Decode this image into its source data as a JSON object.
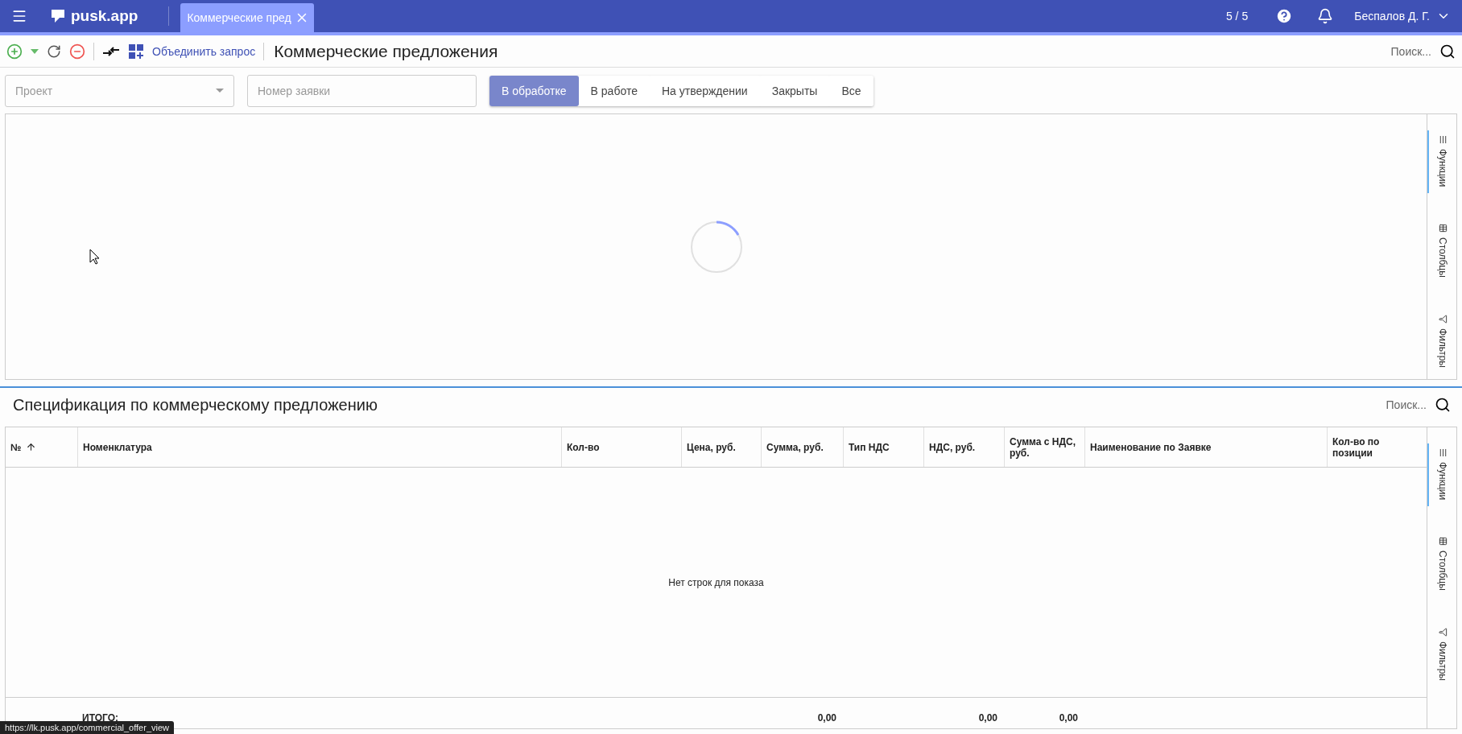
{
  "topbar": {
    "logo": "pusk.app",
    "tab": {
      "label": "Коммерческие пред",
      "selected": true
    },
    "counter": "5 / 5",
    "user": "Беспалов Д. Г."
  },
  "toolbar": {
    "merge_link": "Объединить запрос",
    "title": "Коммерческие предложения",
    "search_placeholder": "Поиск..."
  },
  "filters": {
    "project_placeholder": "Проект",
    "number_placeholder": "Номер заявки",
    "status_tabs": [
      {
        "label": "В обработке",
        "selected": true
      },
      {
        "label": "В работе",
        "selected": false
      },
      {
        "label": "На утверждении",
        "selected": false
      },
      {
        "label": "Закрыты",
        "selected": false
      },
      {
        "label": "Все",
        "selected": false
      }
    ]
  },
  "offers_grid": {
    "loading": true,
    "side_tabs": [
      {
        "kind": "functions",
        "label": "Функции",
        "selected": true
      },
      {
        "kind": "columns",
        "label": "Столбцы",
        "selected": false
      },
      {
        "kind": "filters",
        "label": "Фильтры",
        "selected": false
      }
    ]
  },
  "specification": {
    "title": "Спецификация по коммерческому предложению",
    "search_placeholder": "Поиск...",
    "columns": [
      {
        "label": "№",
        "sorted": true
      },
      {
        "label": "Номенклатура",
        "sorted": false
      },
      {
        "label": "Кол-во",
        "sorted": false
      },
      {
        "label": "Цена, руб.",
        "sorted": false
      },
      {
        "label": "Сумма, руб.",
        "sorted": false,
        "total": "0,00"
      },
      {
        "label": "Тип НДС",
        "sorted": false
      },
      {
        "label": "НДС, руб.",
        "sorted": false,
        "total": "0,00"
      },
      {
        "label": "Сумма с НДС, руб.",
        "sorted": false,
        "total": "0,00"
      },
      {
        "label": "Наименование по Заявке",
        "sorted": false
      },
      {
        "label": "Кол-во по позиции",
        "sorted": false
      }
    ],
    "empty_message": "Нет строк для показа",
    "totals_label": "ИТОГО:",
    "side_tabs": [
      {
        "kind": "functions",
        "label": "Функции",
        "selected": true
      },
      {
        "kind": "columns",
        "label": "Столбцы",
        "selected": false
      },
      {
        "kind": "filters",
        "label": "Фильтры",
        "selected": false
      }
    ]
  },
  "status_url": "https://lk.pusk.app/commercial_offer_view"
}
